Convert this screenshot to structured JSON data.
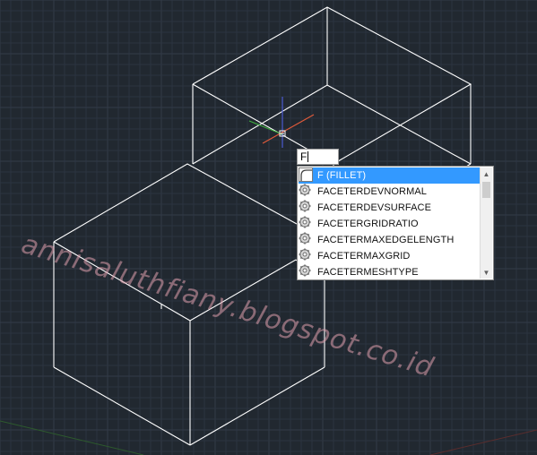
{
  "command_line": {
    "typed_text": "F"
  },
  "autocomplete": {
    "items": [
      {
        "label": "F (FILLET)",
        "icon": "fillet-icon",
        "selected": true
      },
      {
        "label": "FACETERDEVNORMAL",
        "icon": "gear-icon",
        "selected": false
      },
      {
        "label": "FACETERDEVSURFACE",
        "icon": "gear-icon",
        "selected": false
      },
      {
        "label": "FACETERGRIDRATIO",
        "icon": "gear-icon",
        "selected": false
      },
      {
        "label": "FACETERMAXEDGELENGTH",
        "icon": "gear-icon",
        "selected": false
      },
      {
        "label": "FACETERMAXGRID",
        "icon": "gear-icon",
        "selected": false
      },
      {
        "label": "FACETERMESHTYPE",
        "icon": "gear-icon",
        "selected": false
      }
    ],
    "selected_color": "#3399ff"
  },
  "watermark": {
    "text": "annisaluthfiany.blogspot.co.id"
  },
  "colors": {
    "background": "#212830",
    "wireframe": "#ffffff",
    "ucs_x": "#e05a3a",
    "ucs_y": "#3fae3f",
    "ucs_z": "#4a5ad0"
  }
}
